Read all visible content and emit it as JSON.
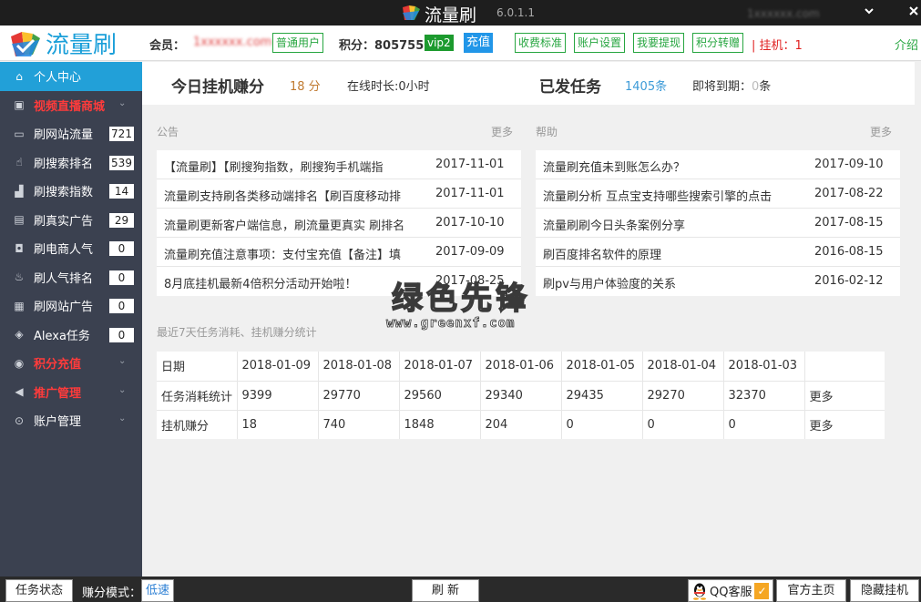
{
  "titlebar": {
    "app_name": "流量刷",
    "version": "6.0.1.1",
    "user_blurred": "1xxxxxx.com",
    "minimize_icon": "minimize-icon",
    "close_icon": "close-icon"
  },
  "header": {
    "brand_name": "流量刷",
    "member_label": "会员：",
    "member_value": "1xxxxxx.com",
    "member_type": "普通用户",
    "points_label": "积分：8057550",
    "vip_badge": "vip2",
    "recharge": "充值",
    "actions": [
      "收费标准",
      "账户设置",
      "我要提现",
      "积分转赠"
    ],
    "hang_status": "| 挂机：1",
    "intro": "介绍"
  },
  "sidebar": {
    "items": [
      {
        "label": "个人中心",
        "icon": "home-icon",
        "active": true
      },
      {
        "label": "视频直播商城",
        "icon": "video-icon",
        "red": true,
        "arrow": true
      },
      {
        "label": "刷网站流量",
        "icon": "laptop-icon",
        "count": "721"
      },
      {
        "label": "刷搜索排名",
        "icon": "hand-icon",
        "count": "539"
      },
      {
        "label": "刷搜索指数",
        "icon": "bar-chart-icon",
        "count": "14"
      },
      {
        "label": "刷真实广告",
        "icon": "ad-icon",
        "count": "29"
      },
      {
        "label": "刷电商人气",
        "icon": "shop-bag-icon",
        "count": "0"
      },
      {
        "label": "刷人气排名",
        "icon": "fire-icon",
        "count": "0"
      },
      {
        "label": "刷网站广告",
        "icon": "web-ad-icon",
        "count": "0"
      },
      {
        "label": "Alexa任务",
        "icon": "shield-icon",
        "count": "0"
      },
      {
        "label": "积分充值",
        "icon": "points-icon",
        "red": true,
        "arrow": true
      },
      {
        "label": "推广管理",
        "icon": "megaphone-icon",
        "red": true,
        "arrow": true
      },
      {
        "label": "账户管理",
        "icon": "account-icon",
        "arrow": true
      }
    ]
  },
  "summary": {
    "today_title": "今日挂机赚分",
    "today_points": "18 分",
    "online_time": "在线时长:0小时",
    "tasks_title": "已发任务",
    "tasks_count": "1405条",
    "expiring_prefix": "即将到期：",
    "expiring_num": "0",
    "expiring_suffix": "条"
  },
  "announcements": {
    "label": "公告",
    "more": "更多",
    "rows": [
      {
        "title": "【流量刷】【刷搜狗指数，刷搜狗手机端指",
        "date": "2017-11-01"
      },
      {
        "title": "流量刷支持刷各类移动端排名【刷百度移动排",
        "date": "2017-11-01"
      },
      {
        "title": "流量刷更新客户端信息，刷流量更真实 刷排名",
        "date": "2017-10-10"
      },
      {
        "title": "流量刷充值注意事项：支付宝充值【备注】填",
        "date": "2017-09-09"
      },
      {
        "title": "8月底挂机最新4倍积分活动开始啦！",
        "date": "2017-08-25"
      }
    ]
  },
  "help": {
    "label": "帮助",
    "more": "更多",
    "rows": [
      {
        "title": "流量刷充值未到账怎么办？",
        "date": "2017-09-10"
      },
      {
        "title": "流量刷分析 互点宝支持哪些搜索引擎的点击",
        "date": "2017-08-22"
      },
      {
        "title": "流量刷刷今日头条案例分享",
        "date": "2017-08-15"
      },
      {
        "title": "刷百度排名软件的原理",
        "date": "2016-08-15"
      },
      {
        "title": "刷pv与用户体验度的关系",
        "date": "2016-02-12"
      }
    ]
  },
  "stats": {
    "label": "最近7天任务消耗、挂机赚分统计",
    "header": [
      "日期",
      "2018-01-09",
      "2018-01-08",
      "2018-01-07",
      "2018-01-06",
      "2018-01-05",
      "2018-01-04",
      "2018-01-03",
      ""
    ],
    "rows": [
      [
        "任务消耗统计",
        "9399",
        "29770",
        "29560",
        "29340",
        "29435",
        "29270",
        "32370",
        "更多"
      ],
      [
        "挂机赚分",
        "18",
        "740",
        "1848",
        "204",
        "0",
        "0",
        "0",
        "更多"
      ]
    ]
  },
  "watermark": {
    "cn": "绿色先锋",
    "url": "www.greenxf.com"
  },
  "bottombar": {
    "task_status": "任务状态",
    "mode_label": "赚分模式：",
    "mode_value": "低速",
    "refresh": "刷 新",
    "qq_service": "QQ客服",
    "official": "官方主页",
    "hide": "隐藏挂机"
  },
  "colors": {
    "sidebar_bg": "#3b4150",
    "active_blue": "#22a0d8",
    "brand_green": "#27a640",
    "alert_red": "#e02020"
  }
}
